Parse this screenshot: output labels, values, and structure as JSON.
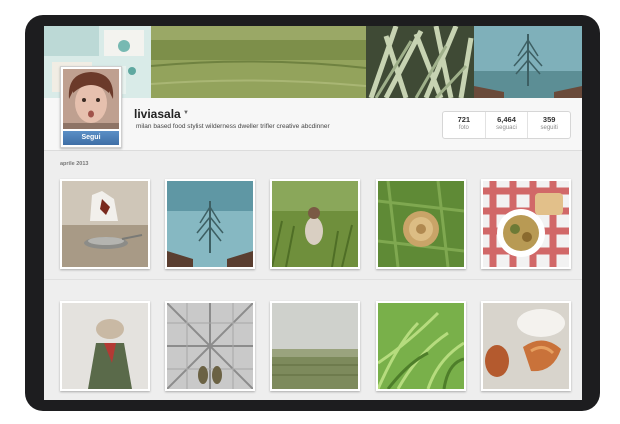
{
  "profile": {
    "username": "liviasala",
    "bio": "milan based food stylist wilderness dweller trifler creative abcdinner",
    "follow_label": "Segui"
  },
  "stats": [
    {
      "value": "721",
      "label": "foto"
    },
    {
      "value": "6,464",
      "label": "seguaci"
    },
    {
      "value": "359",
      "label": "seguiti"
    }
  ],
  "feed": {
    "section_label": "aprile 2013"
  },
  "icons": {
    "username_menu": "chevron-down-icon"
  },
  "colors": {
    "follow_button": "#4a7db5",
    "device_frame": "#1d1d1f",
    "page_background": "#eeeeee"
  }
}
